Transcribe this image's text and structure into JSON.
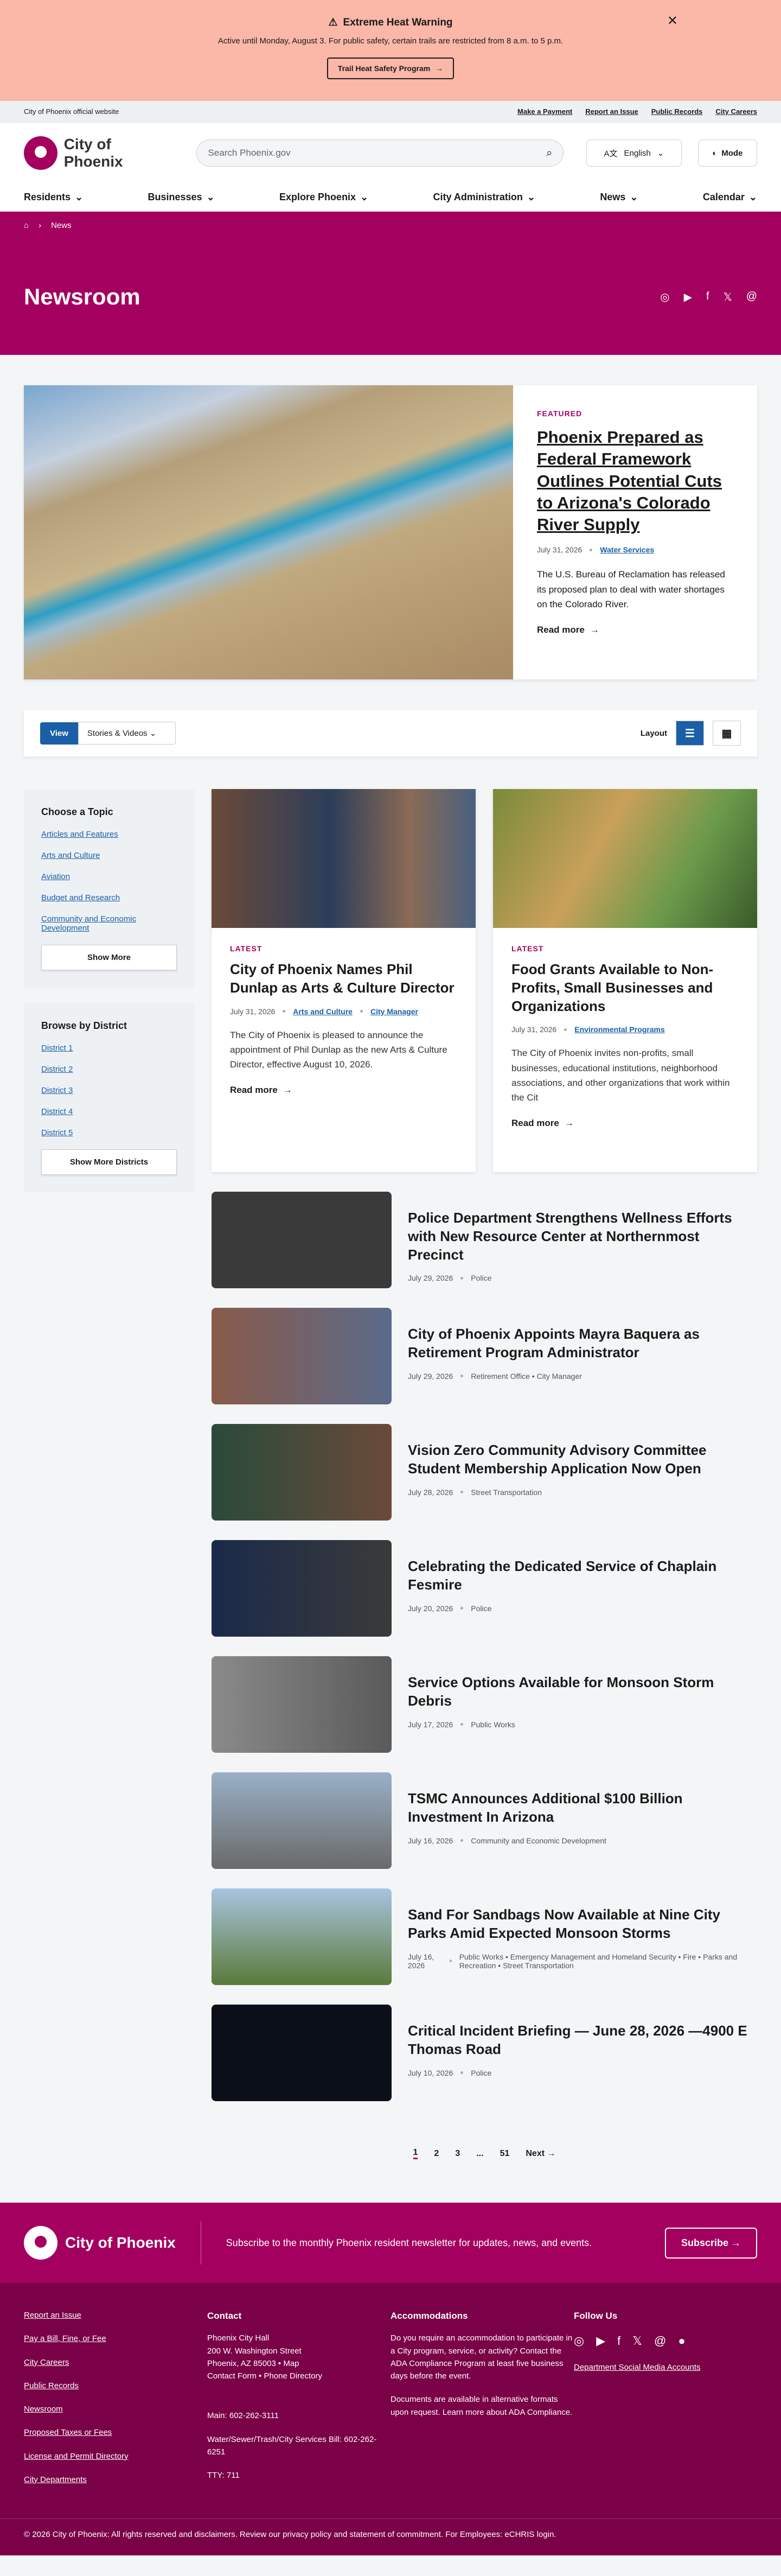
{
  "alert": {
    "title": "Extreme Heat Warning",
    "desc": "Active until Monday, August 3. For public safety, certain trails are restricted from 8 a.m. to 5 p.m.",
    "button": "Trail Heat Safety Program"
  },
  "utility": {
    "official": "City of Phoenix official website",
    "links": [
      "Make a Payment",
      "Report an Issue",
      "Public Records",
      "City Careers"
    ]
  },
  "header": {
    "logo": "City of Phoenix",
    "search_placeholder": "Search Phoenix.gov",
    "lang": "English",
    "mode": "Mode"
  },
  "nav": [
    "Residents",
    "Businesses",
    "Explore Phoenix",
    "City Administration",
    "News",
    "Calendar"
  ],
  "crumb": {
    "current": "News"
  },
  "hero": {
    "title": "Newsroom"
  },
  "featured": {
    "badge": "FEATURED",
    "title": "Phoenix Prepared as Federal Framework Outlines Potential Cuts to Arizona's Colorado River Supply",
    "date": "July 31, 2026",
    "tag": "Water Services",
    "desc": "The U.S. Bureau of Reclamation has released its proposed plan to deal with water shortages on the Colorado River.",
    "read": "Read more"
  },
  "filters": {
    "view": "View",
    "type": "Stories & Videos",
    "layout": "Layout"
  },
  "sidebar": {
    "topic_title": "Choose a Topic",
    "topics": [
      "Articles and Features",
      "Arts and Culture",
      "Aviation",
      "Budget and Research",
      "Community and Economic Development"
    ],
    "show_more": "Show More",
    "district_title": "Browse by District",
    "districts": [
      "District 1",
      "District 2",
      "District 3",
      "District 4",
      "District 5"
    ],
    "show_more_districts": "Show More Districts"
  },
  "cards": [
    {
      "badge": "LATEST",
      "title": "City of Phoenix Names Phil Dunlap as Arts & Culture Director",
      "date": "July 31, 2026",
      "tags": [
        "Arts and Culture",
        "City Manager"
      ],
      "desc": "The City of Phoenix is pleased to announce the appointment of Phil Dunlap as the new Arts & Culture Director, effective August 10, 2026.",
      "read": "Read more"
    },
    {
      "badge": "LATEST",
      "title": "Food Grants Available to Non-Profits, Small Businesses and Organizations",
      "date": "July 31, 2026",
      "tags": [
        "Environmental Programs"
      ],
      "desc": "The City of Phoenix invites non-profits, small businesses, educational institutions, neighborhood associations, and other organizations that work within the Cit",
      "read": "Read more"
    }
  ],
  "rows": [
    {
      "title": "Police Department Strengthens Wellness Efforts with New Resource Center at Northernmost Precinct",
      "date": "July 29, 2026",
      "tags": "Police"
    },
    {
      "title": "City of Phoenix Appoints Mayra Baquera as Retirement Program Administrator",
      "date": "July 29, 2026",
      "tags": "Retirement Office • City Manager"
    },
    {
      "title": "Vision Zero Community Advisory Committee Student Membership Application Now Open",
      "date": "July 28, 2026",
      "tags": "Street Transportation"
    },
    {
      "title": "Celebrating the Dedicated Service of Chaplain Fesmire",
      "date": "July 20, 2026",
      "tags": "Police"
    },
    {
      "title": "Service Options Available for Monsoon Storm Debris",
      "date": "July 17, 2026",
      "tags": "Public Works"
    },
    {
      "title": "TSMC Announces Additional $100 Billion Investment In Arizona",
      "date": "July 16, 2026",
      "tags": "Community and Economic Development"
    },
    {
      "title": "Sand For Sandbags Now Available at Nine City Parks Amid Expected Monsoon Storms",
      "date": "July 16, 2026",
      "tags": "Public Works • Emergency Management and Homeland Security • Fire • Parks and Recreation • Street Transportation"
    },
    {
      "title": "Critical Incident Briefing — June 28, 2026 —4900 E Thomas Road",
      "date": "July 10, 2026",
      "tags": "Police"
    }
  ],
  "pager": {
    "pages": [
      "1",
      "2",
      "3",
      "...",
      "51"
    ],
    "next": "Next"
  },
  "footer": {
    "logo": "City of Phoenix",
    "newsletter": "Subscribe to the monthly Phoenix resident newsletter for updates, news, and events.",
    "subscribe": "Subscribe",
    "links": [
      "Report an Issue",
      "Pay a Bill, Fine, or Fee",
      "City Careers",
      "Public Records",
      "Newsroom",
      "Proposed Taxes or Fees",
      "License and Permit Directory",
      "City Departments"
    ],
    "contact_title": "Contact",
    "contact": "Phoenix City Hall\n200 W. Washington Street\nPhoenix, AZ 85003 • Map\nContact Form • Phone Directory",
    "main": "Main: 602-262-3111",
    "water": "Water/Sewer/Trash/City Services Bill: 602-262-6251",
    "tty": "TTY: 711",
    "acc_title": "Accommodations",
    "acc": "Do you require an accommodation to participate in a City program, service, or activity? Contact the ADA Compliance Program at least five business days before the event.",
    "acc2": "Documents are available in alternative formats upon request. Learn more about ADA Compliance.",
    "follow": "Follow Us",
    "social_link": "Department Social Media Accounts",
    "copyright": "© 2026 City of Phoenix: All rights reserved and disclaimers. Review our privacy policy and statement of commitment. For Employees: eCHRIS login."
  }
}
